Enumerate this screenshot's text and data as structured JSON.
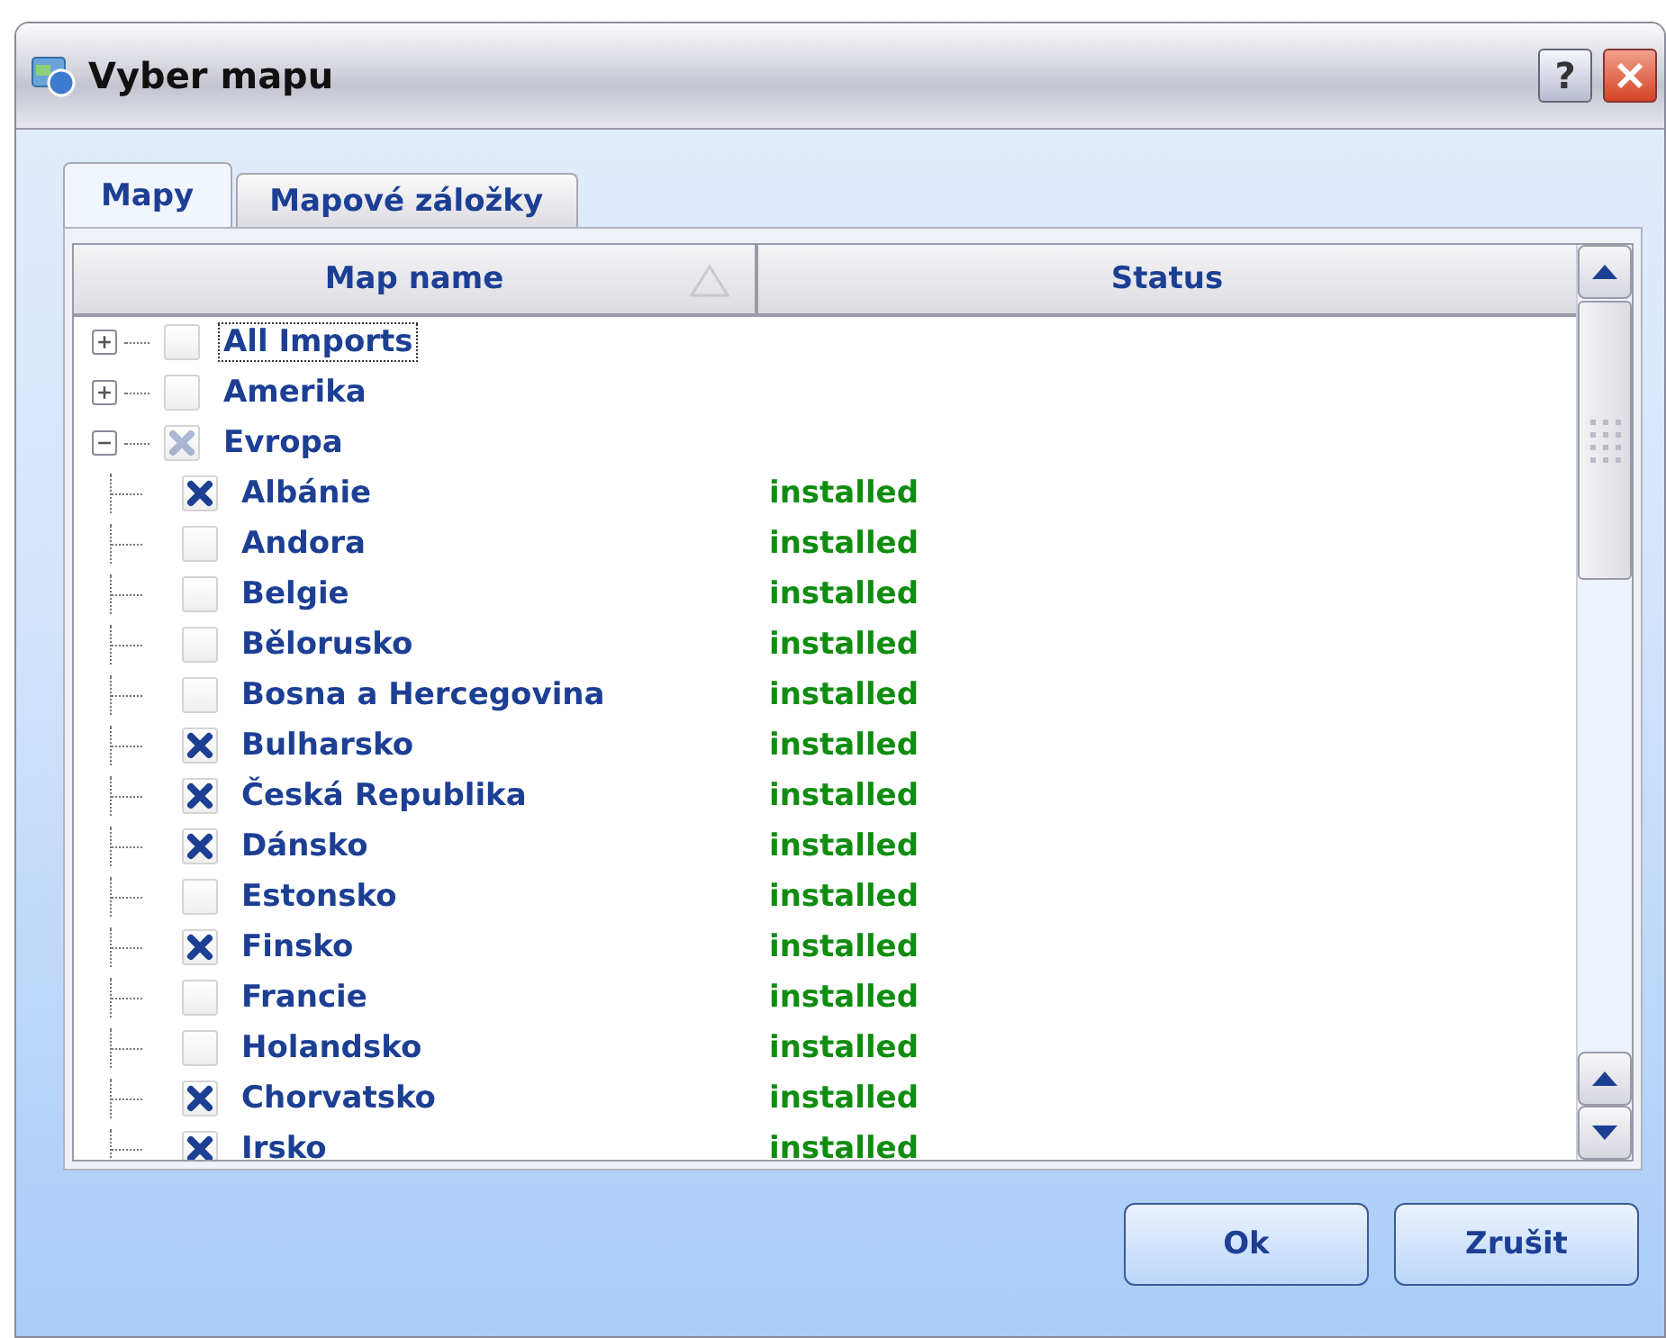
{
  "window": {
    "title": "Vyber mapu",
    "help_button": "?"
  },
  "tabs": [
    {
      "label": "Mapy",
      "selected": true
    },
    {
      "label": "Mapové záložky",
      "selected": false
    }
  ],
  "table": {
    "columns": [
      "Map name",
      "Status"
    ],
    "rows": [
      {
        "name": "All Imports",
        "expanded": false,
        "checked": false,
        "focused": true
      },
      {
        "name": "Amerika",
        "expanded": false,
        "checked": false,
        "focused": false
      },
      {
        "name": "Evropa",
        "expanded": true,
        "partial": true,
        "focused": false,
        "children": [
          {
            "name": "Albánie",
            "status": "installed",
            "checked": true
          },
          {
            "name": "Andora",
            "status": "installed",
            "checked": false
          },
          {
            "name": "Belgie",
            "status": "installed",
            "checked": false
          },
          {
            "name": "Bělorusko",
            "status": "installed",
            "checked": false
          },
          {
            "name": "Bosna a Hercegovina",
            "status": "installed",
            "checked": false
          },
          {
            "name": "Bulharsko",
            "status": "installed",
            "checked": true
          },
          {
            "name": "Česká Republika",
            "status": "installed",
            "checked": true
          },
          {
            "name": "Dánsko",
            "status": "installed",
            "checked": true
          },
          {
            "name": "Estonsko",
            "status": "installed",
            "checked": false
          },
          {
            "name": "Finsko",
            "status": "installed",
            "checked": true
          },
          {
            "name": "Francie",
            "status": "installed",
            "checked": false
          },
          {
            "name": "Holandsko",
            "status": "installed",
            "checked": false
          },
          {
            "name": "Chorvatsko",
            "status": "installed",
            "checked": true
          },
          {
            "name": "Irsko",
            "status": "installed",
            "checked": true
          }
        ]
      }
    ]
  },
  "buttons": [
    "Ok",
    "Zrušit"
  ]
}
